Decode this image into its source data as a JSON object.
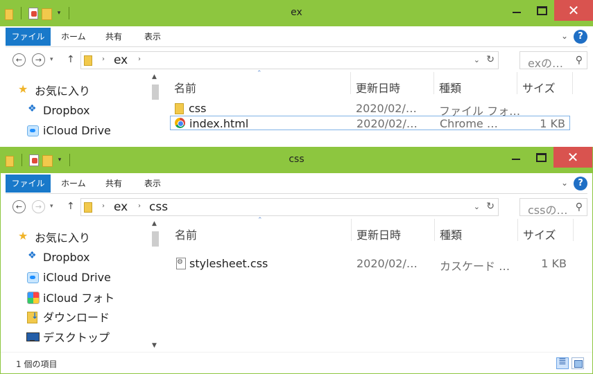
{
  "windows": [
    {
      "title": "ex",
      "ribbon": {
        "tabs": [
          "ファイル",
          "ホーム",
          "共有",
          "表示"
        ]
      },
      "address": {
        "crumbs": [
          "ex"
        ],
        "search_placeholder": "exの…"
      },
      "nav_items": [
        {
          "label": "お気に入り",
          "icon": "star-icon"
        },
        {
          "label": "Dropbox",
          "icon": "dropbox-icon"
        },
        {
          "label": "iCloud Drive",
          "icon": "icloud-drive-icon"
        }
      ],
      "columns": [
        "名前",
        "更新日時",
        "種類",
        "サイズ"
      ],
      "files": [
        {
          "name": "css",
          "date": "2020/02/…",
          "type": "ファイル フォ…",
          "size": "",
          "icon": "folder-icon"
        },
        {
          "name": "index.html",
          "date": "2020/02/…",
          "type": "Chrome …",
          "size": "1 KB",
          "icon": "chrome-icon"
        }
      ]
    },
    {
      "title": "css",
      "ribbon": {
        "tabs": [
          "ファイル",
          "ホーム",
          "共有",
          "表示"
        ]
      },
      "address": {
        "crumbs": [
          "ex",
          "css"
        ],
        "search_placeholder": "cssの…"
      },
      "nav_items": [
        {
          "label": "お気に入り",
          "icon": "star-icon"
        },
        {
          "label": "Dropbox",
          "icon": "dropbox-icon"
        },
        {
          "label": "iCloud Drive",
          "icon": "icloud-drive-icon"
        },
        {
          "label": "iCloud フォト",
          "icon": "icloud-photos-icon"
        },
        {
          "label": "ダウンロード",
          "icon": "downloads-icon"
        },
        {
          "label": "デスクトップ",
          "icon": "desktop-icon"
        }
      ],
      "columns": [
        "名前",
        "更新日時",
        "種類",
        "サイズ"
      ],
      "files": [
        {
          "name": "stylesheet.css",
          "date": "2020/02/…",
          "type": "カスケード …",
          "size": "1 KB",
          "icon": "css-file-icon"
        }
      ],
      "status": "1 個の項目"
    }
  ],
  "colors": {
    "titlebar": "#8dc63f",
    "close": "#d9534f",
    "file_tab": "#1979ca",
    "selection_border": "#7fb2e6"
  }
}
